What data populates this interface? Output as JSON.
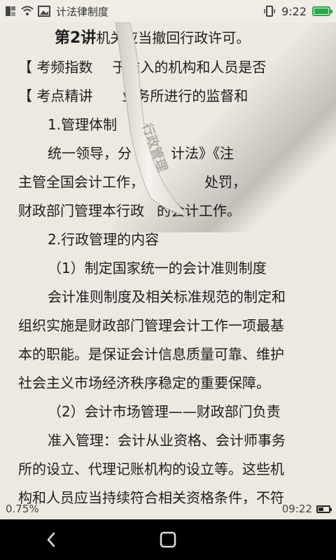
{
  "status_bar": {
    "app_title": "计法律制度",
    "time": "9:22",
    "icons": [
      "app-icon",
      "wifi-icon",
      "image-icon",
      "vibrate-icon",
      "battery-icon"
    ],
    "battery_color": "#2aa84a"
  },
  "reader": {
    "lines": [
      {
        "text_a": "第2讲",
        "text_b": "机关应当撤回行政许可。",
        "type": "heading"
      },
      {
        "text": "【 考频指数",
        "text2": "于准入的机构和人员是否",
        "type": "para"
      },
      {
        "text": "【 考点精讲",
        "text2": "业务所进行的监督和",
        "type": "para"
      },
      {
        "text": "1.管理体制",
        "type": "indent"
      },
      {
        "text": "统一领导，分",
        "text2": "计法》《注",
        "type": "indent"
      },
      {
        "text": "主管全国会计工作，",
        "text2": "处罚，",
        "type": "para"
      },
      {
        "text": "财政部门管理本行政",
        "text2": "的会计工作。",
        "type": "para"
      },
      {
        "text": "2.行政管理的内容",
        "type": "indent"
      },
      {
        "text": "（1）制定国家统一的会计准则制度",
        "type": "indent"
      },
      {
        "text": "会计准则制度及相关标准规范的制定和",
        "type": "indent"
      },
      {
        "text": "组织实施是财政部门管理会计工作一项最基",
        "type": "para"
      },
      {
        "text": "本的职能。是保证会计信息质量可靠、维护",
        "type": "para"
      },
      {
        "text": "社会主义市场经济秩序稳定的重要保障。",
        "type": "para"
      },
      {
        "text": "（2）会计市场管理——财政部门负责",
        "type": "indent"
      },
      {
        "text": "准入管理：会计从业资格、会计师事务",
        "type": "indent"
      },
      {
        "text": "所的设立、代理记账机构的设立等。这些机",
        "type": "para"
      },
      {
        "text": "构和人员应当持续符合相关资格条件，不符",
        "type": "para"
      }
    ],
    "curl_text": "行政管理",
    "page_bg": "#ece9e1"
  },
  "footer": {
    "progress": "0.75%",
    "time": "09:22"
  },
  "navbar": {
    "back_label": "back",
    "home_label": "home"
  }
}
